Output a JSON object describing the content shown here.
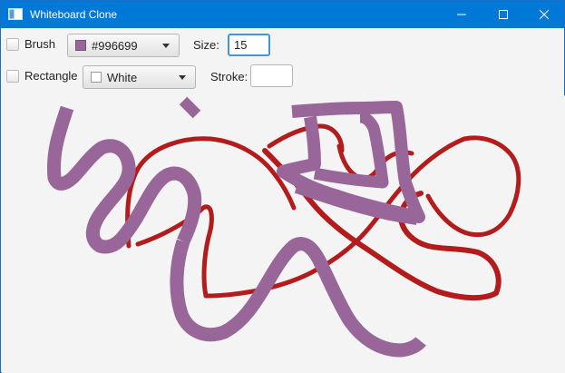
{
  "window": {
    "title": "Whiteboard Clone",
    "icon": "app-window-icon",
    "controls": [
      "minimize-icon",
      "maximize-icon",
      "close-icon"
    ],
    "titlebar_color": "#0078d7"
  },
  "toolbar": {
    "brush": {
      "label": "Brush",
      "checked": false,
      "color_label": "#996699",
      "color_value": "#996699",
      "size_label": "Size:",
      "size_value": "15"
    },
    "rectangle": {
      "label": "Rectangle",
      "checked": false,
      "fill_label": "White",
      "fill_value": "#ffffff",
      "stroke_label": "Stroke:",
      "stroke_value": ""
    }
  },
  "canvas": {
    "background": "#f4f4f4",
    "stroke_colors": {
      "purple": "#996699",
      "red": "#b31c1c"
    }
  }
}
